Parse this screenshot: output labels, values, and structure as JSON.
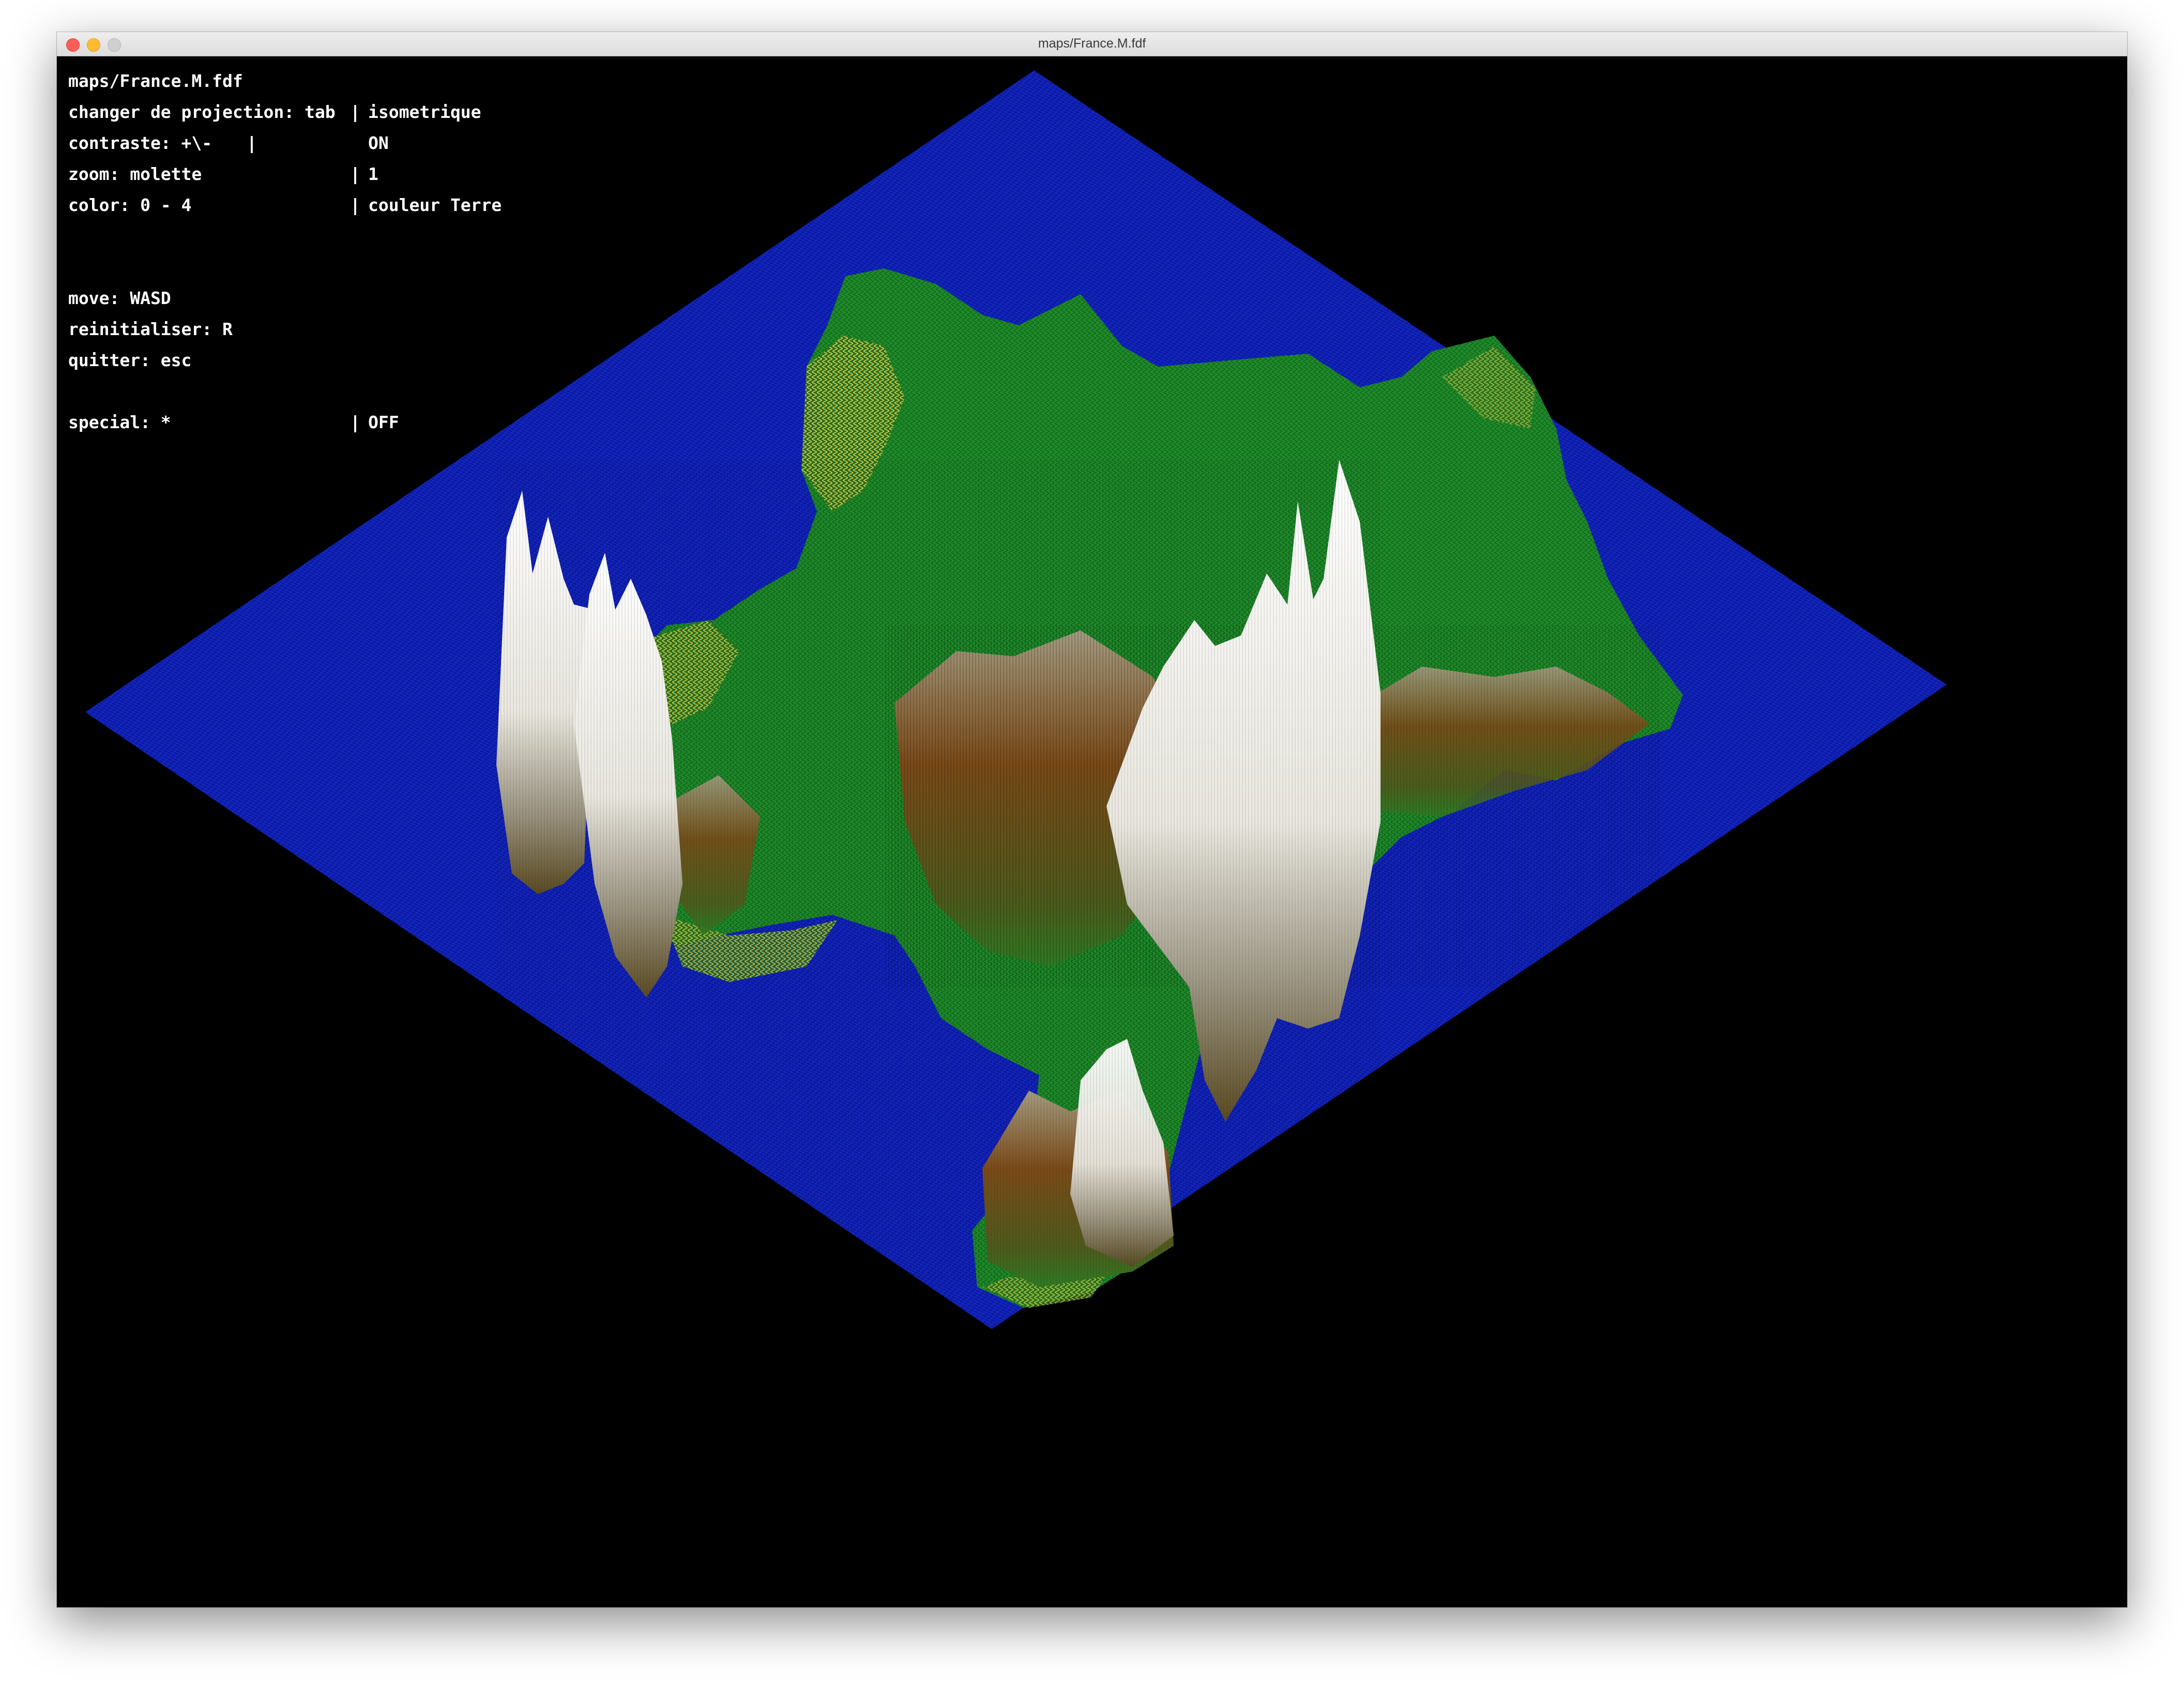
{
  "window": {
    "title": "maps/France.M.fdf"
  },
  "hud": {
    "file": "maps/France.M.fdf",
    "projection": {
      "label": "changer de projection: tab",
      "value": "isometrique"
    },
    "contrast": {
      "label": "contraste: +\\-",
      "value": "ON"
    },
    "zoom": {
      "label": "zoom: molette",
      "value": "1"
    },
    "color": {
      "label": "color: 0 - 4",
      "value": "couleur Terre"
    },
    "move": "move: WASD",
    "reset": "reinitialiser: R",
    "quit": "quitter: esc",
    "special": {
      "label": "special: *",
      "value": "OFF"
    },
    "separator": "|"
  },
  "palette": {
    "sea": "#0a1aa8",
    "sea_grid": "#2c3fd8",
    "lowland": "#1f8a2a",
    "coast": "#c9c13a",
    "hill": "#6b5a22",
    "mountain": "#7a4a18",
    "peak": "#f4f4f0",
    "background": "#000000"
  }
}
